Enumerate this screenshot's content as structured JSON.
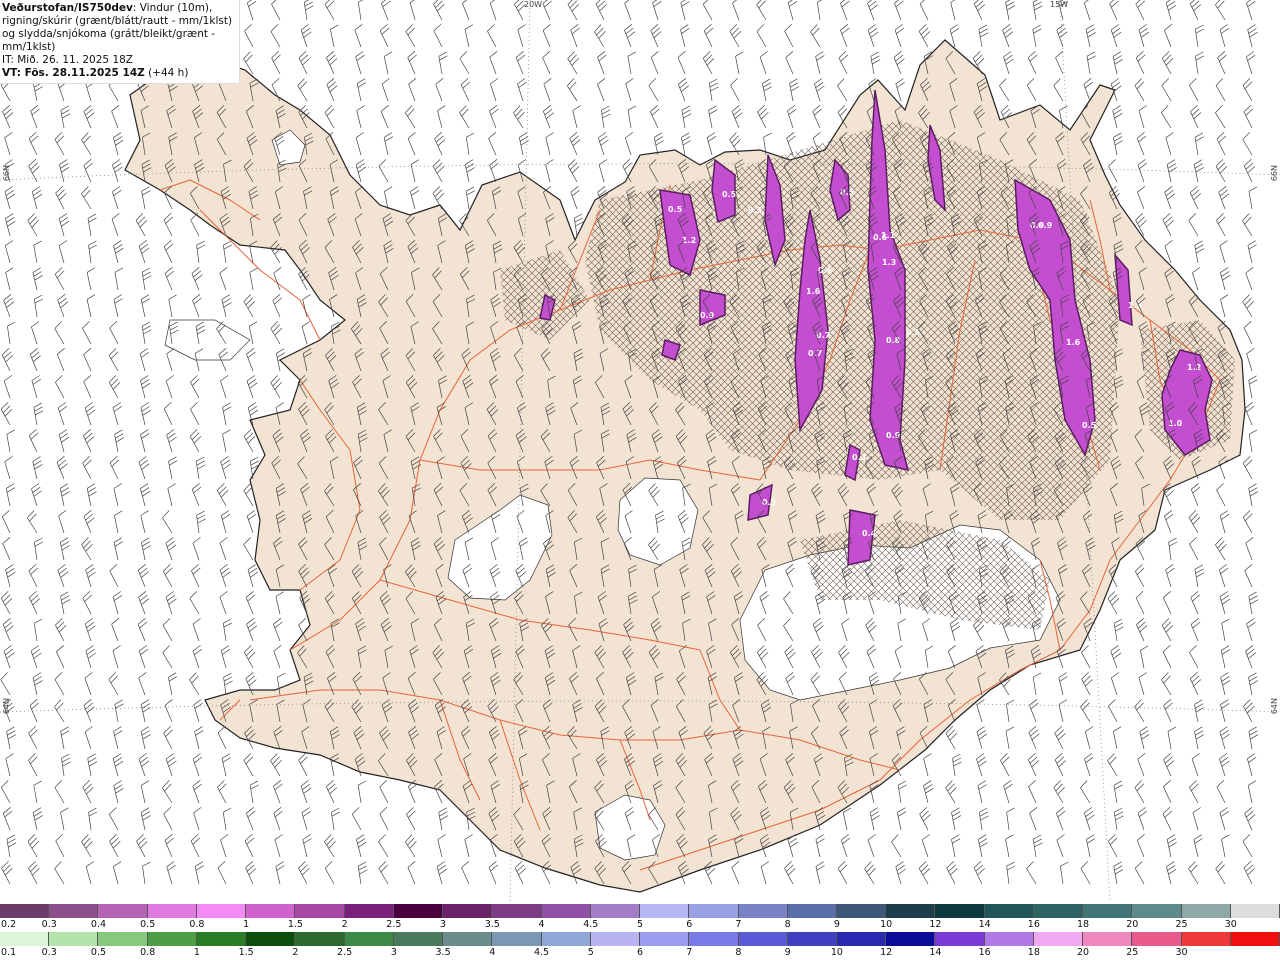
{
  "header": {
    "source": "Veðurstofan/IS750dev",
    "description": ": Vindur (10m), rigning/skúrir (grænt/blátt/rautt - mm/1klst) og slydda/snjókoma (grátt/bleikt/grænt - mm/1klst)",
    "issue_time": "IT: Mið. 26. 11. 2025 18Z",
    "valid_time_prefix": "VT: ",
    "valid_time": "Fös. 28.11.2025 14Z",
    "valid_offset": " (+44 h)"
  },
  "grid_labels": {
    "lon_20w": "20W",
    "lon_15w": "15W",
    "lat_66n_left": "66N",
    "lat_66n_right": "66N",
    "lat_64n_left": "64N",
    "lat_64n_right": "64N"
  },
  "map_labels": [
    "0.5",
    "0.5",
    "0.5",
    "0.5",
    "0.6",
    "1.6",
    "0.7",
    "0.7",
    "0.6",
    "1.1",
    "1.3",
    "0.9",
    "0.8",
    "0.5",
    "0.9",
    "0.3",
    "0.3",
    "0.4",
    "0.9",
    "1.2",
    "1.3",
    "1.6",
    "0.5",
    "1.0",
    "1.2",
    "0.9"
  ],
  "colors": {
    "land": "#f2e3d3",
    "coast": "#222222",
    "roads": "#e8643a",
    "glacier": "#ffffff",
    "precip_light": "#e87be8",
    "precip_core": "#b03cc0",
    "precip_edge": "#5a1d5f"
  },
  "legend": {
    "snow_labels": [
      "0.2",
      "0.3",
      "0.4",
      "0.5",
      "0.8",
      "1",
      "1.5",
      "2",
      "2.5",
      "3",
      "3.5",
      "4",
      "4.5",
      "5",
      "6",
      "7",
      "8",
      "9",
      "10",
      "12",
      "14",
      "16",
      "18",
      "20",
      "25",
      "30"
    ],
    "snow_colors": [
      "#6a3a6a",
      "#8c4f8c",
      "#b463b4",
      "#e07ae0",
      "#f48af4",
      "#cf62cf",
      "#a549a5",
      "#7a1f7a",
      "#4a0040",
      "#6a2368",
      "#7e3b86",
      "#9050a6",
      "#a37ec7",
      "#b7b6f4",
      "#9aa0e6",
      "#7883c8",
      "#5a6ea8",
      "#3d5878",
      "#1d3d4d",
      "#0c3a3c",
      "#1f5658",
      "#2d6464",
      "#437676",
      "#5f8a8a",
      "#8ea8a8",
      "#dcdcdc"
    ],
    "rain_labels": [
      "0.1",
      "0.3",
      "0.5",
      "0.8",
      "1",
      "1.5",
      "2",
      "2.5",
      "3",
      "3.5",
      "4",
      "4.5",
      "5",
      "6",
      "7",
      "8",
      "9",
      "10",
      "12",
      "14",
      "16",
      "18",
      "20",
      "25",
      "30"
    ],
    "rain_colors": [
      "#dcf6d8",
      "#b4e4aa",
      "#86c97c",
      "#4e9e46",
      "#2a7c25",
      "#0c4e0c",
      "#2e6a2e",
      "#3d8a46",
      "#4a7a5c",
      "#6a8c8c",
      "#7a98b4",
      "#8fa6d6",
      "#b8b4f4",
      "#9c9cf0",
      "#7a7ae6",
      "#5a5ad6",
      "#3f3fc0",
      "#2828b0",
      "#0c0c9a",
      "#7a3ad6",
      "#b079e6",
      "#f0a8f0",
      "#f088c0",
      "#e85a8c",
      "#f03a3a",
      "#f01010"
    ]
  }
}
